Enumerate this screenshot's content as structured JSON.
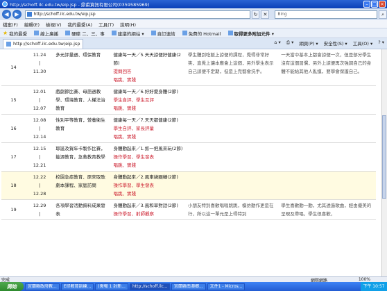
{
  "window": {
    "title": "http://schoff.ilc.edu.tw/eip.jsp - 鼎甫資訊有限公司(0359585969)"
  },
  "address": {
    "url": "http://schoff.ilc.edu.tw/eip.jsp",
    "search_placeholder": "Bing"
  },
  "menu": [
    "檔案(F)",
    "編輯(E)",
    "檢視(V)",
    "我的最愛(A)",
    "工具(T)",
    "說明(H)"
  ],
  "favorites": {
    "label": "我的最愛",
    "items": [
      "線上廣播",
      "硬碟 二、三、事",
      "建議的網站 ▾",
      "自訂連結",
      "免費的 Hotmail",
      "取得更多附加元件 ▾"
    ]
  },
  "tab": {
    "label": "http://schoff.ilc.edu.tw/eip.jsp"
  },
  "tabtools": [
    "網頁(P) ▾",
    "安全性(S) ▾",
    "工具(O) ▾"
  ],
  "rows": [
    {
      "no": "14",
      "date_from": "11.24",
      "date_sep": "|",
      "date_to": "11.30",
      "topic": "多元評量週、環保教育",
      "content": "健康每一天／5.天天諒便好健康(2節)",
      "methods": [
        "提問回答",
        "唱跳、實踐"
      ],
      "goal": "學生體到吃飯上諒便的課程，覺得非常好笑，直覺上讓本應會上這個，另外學生表示自己諒便不定期，但是上完都會洗手。",
      "note": "一天當中基本上都會諒便一次，但是部分學生沒有這個習慣，另外上諒便再次強調自己的身體不能給其他人亂摸，要學會保護自己。",
      "hl": false
    },
    {
      "no": "15",
      "date_from": "12.01",
      "date_sep": "|",
      "date_to": "12.07",
      "topic": "戲劇節比賽、母語週教學、環境教育、人權法治教育",
      "content": "健康每一天／6.好好愛身體(2節)",
      "methods": [
        "學生自評、學生互評",
        "唱跳、實踐"
      ],
      "goal": "",
      "note": "",
      "hl": false
    },
    {
      "no": "16",
      "date_from": "12.08",
      "date_sep": "|",
      "date_to": "12.14",
      "topic": "性別平等教育，營養衛生教育",
      "content": "健康每一天／7.天天都健康(2節)",
      "methods": [
        "學生自評、家長評量",
        "唱跳、實踐"
      ],
      "goal": "",
      "note": "",
      "hl": false
    },
    {
      "no": "17",
      "date_from": "12.15",
      "date_sep": "|",
      "date_to": "12.21",
      "topic": "耶誕及賀年卡製作比賽，能源教育，急救教育教學",
      "content": "身體動起來／1.抓一把風來玩(2節)",
      "methods": [
        "操作學習、學生發表",
        "唱跳、實踐"
      ],
      "goal": "",
      "note": "",
      "hl": false
    },
    {
      "no": "18",
      "date_from": "12.22",
      "date_sep": "|",
      "date_to": "12.28",
      "topic": "校園急症教育、原來取歌劇本課程、家庭訪問",
      "content": "身體動起來／2.風車繞圈轉(2節)",
      "methods": [
        "操作學習、學生發表",
        "唱跳、實踐"
      ],
      "goal": "",
      "note": "",
      "hl": true
    },
    {
      "no": "19",
      "date_from": "12.29",
      "date_sep": "|",
      "date_to": "",
      "topic": "各項學習活動資料成果發表",
      "content": "身體動起來／3.風和草對話(2節)",
      "methods": [
        "操作學習、射師觀察"
      ],
      "goal": "小朋友特別喜歡唱唱跳跳，模仿動作更是在行，所以這一單元是上得特別",
      "note": "學生喜歡動一動，尤其透過歌曲，經由優美的呈現及帶唱，學生很喜歡，",
      "hl": false
    }
  ],
  "status": {
    "left": "完成",
    "zone": "網際網路",
    "zoom": "100%"
  },
  "taskbar": {
    "start": "開始",
    "items": [
      "宜蘭縣政府教...",
      "E印教育訓練...",
      "(需報 1 封新...",
      "http://schoff.ilc...",
      "宜蘭縣南澳鄉...",
      "文件1 - Micros..."
    ],
    "clock": "下午 10:57"
  }
}
